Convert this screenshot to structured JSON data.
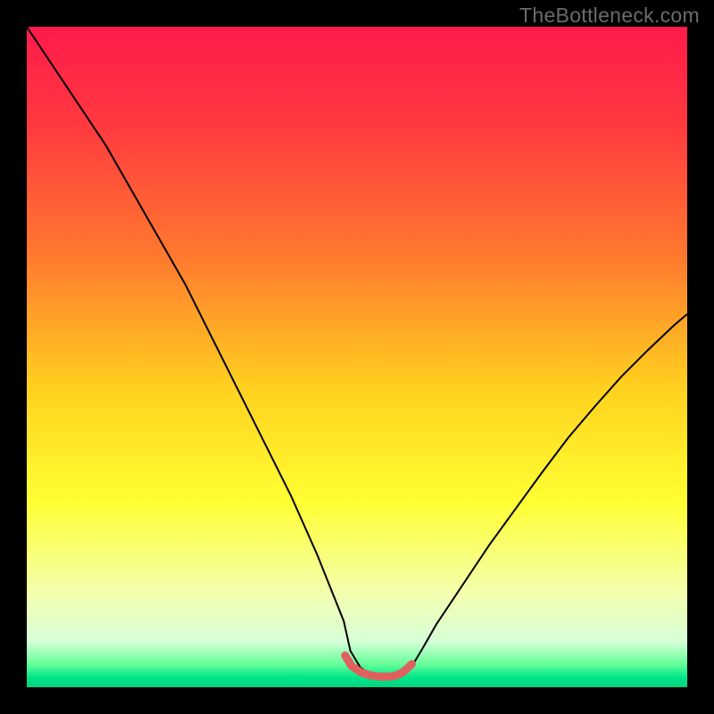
{
  "watermark": "TheBottleneck.com",
  "chart_data": {
    "type": "line",
    "title": "",
    "xlabel": "",
    "ylabel": "",
    "xlim": [
      0,
      100
    ],
    "ylim": [
      0,
      100
    ],
    "gradient_stops": [
      {
        "offset": 0.0,
        "color": "#ff1a4b"
      },
      {
        "offset": 0.15,
        "color": "#ff3a3f"
      },
      {
        "offset": 0.35,
        "color": "#ff7a2e"
      },
      {
        "offset": 0.55,
        "color": "#ffd21f"
      },
      {
        "offset": 0.72,
        "color": "#ffff33"
      },
      {
        "offset": 0.86,
        "color": "#f3ffb0"
      },
      {
        "offset": 0.93,
        "color": "#d8ffd8"
      },
      {
        "offset": 0.965,
        "color": "#66ff99"
      },
      {
        "offset": 0.985,
        "color": "#00e68a"
      },
      {
        "offset": 1.0,
        "color": "#00d37d"
      }
    ],
    "series": [
      {
        "name": "bottleneck-curve",
        "stroke": "#000000",
        "stroke_width": 2,
        "x": [
          0,
          4,
          8,
          12,
          16,
          20,
          24,
          28,
          32,
          36,
          40,
          44,
          48,
          49,
          50.5,
          52,
          53.5,
          55,
          56,
          57,
          58.5,
          60,
          62,
          66,
          70,
          74,
          78,
          82,
          86,
          90,
          94,
          98,
          100
        ],
        "y": [
          100,
          94,
          88,
          82,
          75,
          68,
          61,
          53,
          45,
          37,
          29,
          20,
          10,
          5.5,
          3.0,
          2.0,
          1.5,
          1.5,
          1.6,
          2.0,
          3.5,
          6.0,
          9.5,
          15.5,
          21.5,
          27.0,
          32.5,
          37.8,
          42.5,
          47.0,
          51.0,
          54.8,
          56.5
        ]
      },
      {
        "name": "bottom-marker",
        "stroke": "#e06060",
        "stroke_width": 9,
        "linecap": "round",
        "x": [
          48.2,
          49.2,
          50.5,
          52.0,
          53.5,
          55.0,
          56.0,
          57.0,
          58.3
        ],
        "y": [
          4.8,
          3.2,
          2.3,
          1.8,
          1.6,
          1.6,
          1.8,
          2.3,
          3.5
        ]
      }
    ]
  }
}
